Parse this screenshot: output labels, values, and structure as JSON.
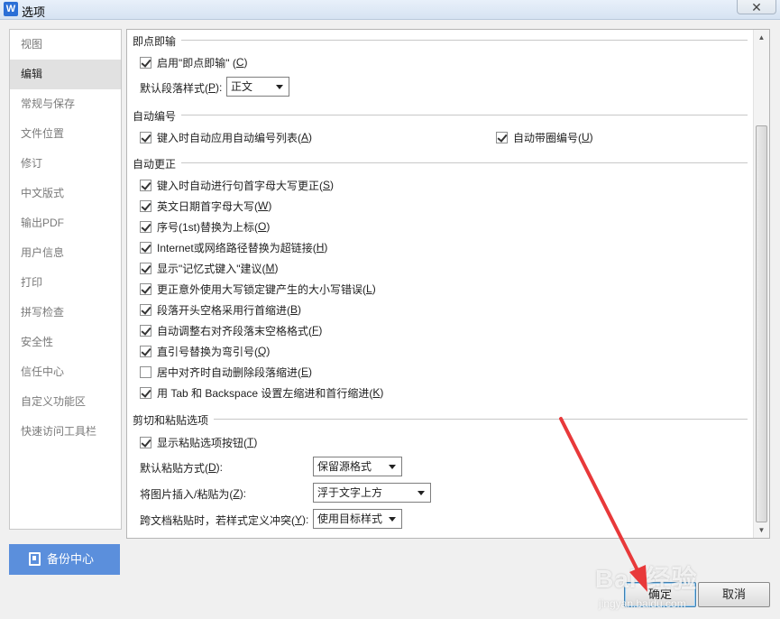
{
  "window": {
    "title": "选项",
    "close_label": "✕"
  },
  "sidebar": {
    "items": [
      {
        "label": "视图"
      },
      {
        "label": "编辑"
      },
      {
        "label": "常规与保存"
      },
      {
        "label": "文件位置"
      },
      {
        "label": "修订"
      },
      {
        "label": "中文版式"
      },
      {
        "label": "输出PDF"
      },
      {
        "label": "用户信息"
      },
      {
        "label": "打印"
      },
      {
        "label": "拼写检查"
      },
      {
        "label": "安全性"
      },
      {
        "label": "信任中心"
      },
      {
        "label": "自定义功能区"
      },
      {
        "label": "快速访问工具栏"
      }
    ],
    "active_index": 1,
    "backup_label": "备份中心"
  },
  "sections": {
    "instant_input": {
      "title": "即点即输",
      "enable": {
        "text": "启用\"即点即输\" (",
        "key": "C",
        "suffix": ")",
        "checked": true
      },
      "default_style_label": {
        "text": "默认段落样式(",
        "key": "P",
        "suffix": "):"
      },
      "default_style_value": "正文"
    },
    "auto_number": {
      "title": "自动编号",
      "left": {
        "text": "键入时自动应用自动编号列表(",
        "key": "A",
        "suffix": ")",
        "checked": true
      },
      "right": {
        "text": "自动带圈编号(",
        "key": "U",
        "suffix": ")",
        "checked": true
      }
    },
    "auto_correct": {
      "title": "自动更正",
      "items": [
        {
          "text": "键入时自动进行句首字母大写更正(",
          "key": "S",
          "suffix": ")",
          "checked": true
        },
        {
          "text": "英文日期首字母大写(",
          "key": "W",
          "suffix": ")",
          "checked": true
        },
        {
          "text": "序号(1st)替换为上标(",
          "key": "O",
          "suffix": ")",
          "checked": true
        },
        {
          "text": "Internet或网络路径替换为超链接(",
          "key": "H",
          "suffix": ")",
          "checked": true
        },
        {
          "text": "显示\"记忆式键入\"建议(",
          "key": "M",
          "suffix": ")",
          "checked": true
        },
        {
          "text": "更正意外使用大写锁定键产生的大小写错误(",
          "key": "L",
          "suffix": ")",
          "checked": true
        },
        {
          "text": "段落开头空格采用行首缩进(",
          "key": "B",
          "suffix": ")",
          "checked": true
        },
        {
          "text": "自动调整右对齐段落末空格格式(",
          "key": "F",
          "suffix": ")",
          "checked": true
        },
        {
          "text": "直引号替换为弯引号(",
          "key": "Q",
          "suffix": ")",
          "checked": true
        },
        {
          "text": "居中对齐时自动删除段落缩进(",
          "key": "E",
          "suffix": ")",
          "checked": false
        },
        {
          "text": "用 Tab 和 Backspace 设置左缩进和首行缩进(",
          "key": "K",
          "suffix": ")",
          "checked": true
        }
      ]
    },
    "paste": {
      "title": "剪切和粘贴选项",
      "show_btn": {
        "text": "显示粘贴选项按钮(",
        "key": "T",
        "suffix": ")",
        "checked": true
      },
      "default_paste": {
        "text": "默认粘贴方式(",
        "key": "D",
        "suffix": "):",
        "value": "保留源格式"
      },
      "insert_picture": {
        "text": "将图片插入/粘贴为(",
        "key": "Z",
        "suffix": "):",
        "value": "浮于文字上方"
      },
      "cross_doc": {
        "text": "跨文档粘贴时，若样式定义冲突(",
        "key": "Y",
        "suffix": "):",
        "value": "使用目标样式"
      }
    }
  },
  "buttons": {
    "ok": "确定",
    "cancel": "取消"
  },
  "watermark": {
    "main": "Bai 经验",
    "sub": "jingyan.baidu.com"
  },
  "colors": {
    "accent": "#5b8fdc",
    "annotation_arrow": "#e8393a"
  }
}
